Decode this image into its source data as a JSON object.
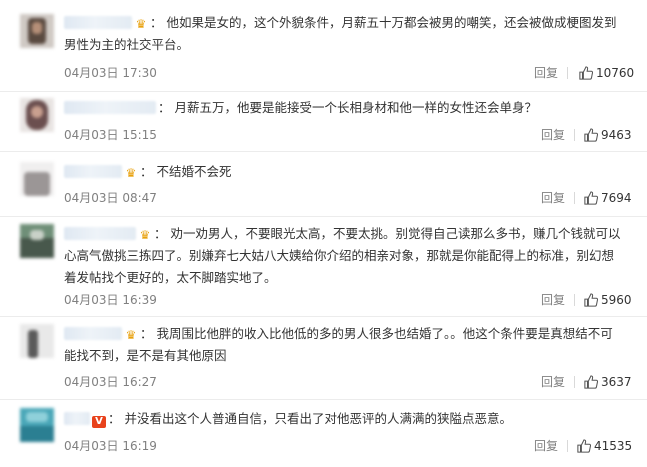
{
  "comments": [
    {
      "text": "他如果是女的，这个外貌条件，月薪五十万都会被男的嘲笑，还会被做成梗图发到男性为主的社交平台。",
      "time": "04月03日 17:30",
      "reply": "回复",
      "likes": "10760",
      "badge": "crown"
    },
    {
      "text": "月薪五万，他要是能接受一个长相身材和他一样的女性还会单身？",
      "time": "04月03日 15:15",
      "reply": "回复",
      "likes": "9463",
      "badge": ""
    },
    {
      "text": "不结婚不会死",
      "time": "04月03日 08:47",
      "reply": "回复",
      "likes": "7694",
      "badge": "crown"
    },
    {
      "text": "劝一劝男人，不要眼光太高，不要太挑。别觉得自己读那么多书，赚几个钱就可以心高气傲挑三拣四了。别嫌弃七大姑八大姨给你介绍的相亲对象，那就是你能配得上的标准，别幻想着发帖找个更好的，太不脚踏实地了。",
      "time": "04月03日 16:39",
      "reply": "回复",
      "likes": "5960",
      "badge": "crown"
    },
    {
      "text": "我周围比他胖的收入比他低的多的男人很多也结婚了。。他这个条件要是真想结不可能找不到，是不是有其他原因",
      "time": "04月03日 16:27",
      "reply": "回复",
      "likes": "3637",
      "badge": "crown"
    },
    {
      "text": "并没看出这个人普通自信，只看出了对他恶评的人满满的狭隘点恶意。",
      "time": "04月03日 16:19",
      "reply": "回复",
      "likes": "41535",
      "badge": "v"
    }
  ],
  "icons": {
    "crown": "crown-icon",
    "v": "v-badge-icon",
    "like": "thumbs-up-icon"
  },
  "badge_v_text": "V"
}
